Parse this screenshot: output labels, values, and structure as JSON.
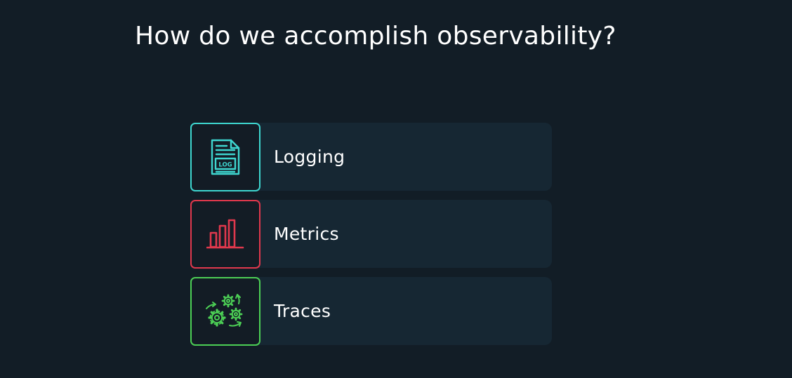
{
  "title": "How do we accomplish observability?",
  "items": [
    {
      "label": "Logging",
      "icon": "log-file-icon",
      "color": "#3ed6cf",
      "badge": "LOG"
    },
    {
      "label": "Metrics",
      "icon": "bar-chart-icon",
      "color": "#e0384d"
    },
    {
      "label": "Traces",
      "icon": "gears-icon",
      "color": "#4ccf55"
    }
  ]
}
